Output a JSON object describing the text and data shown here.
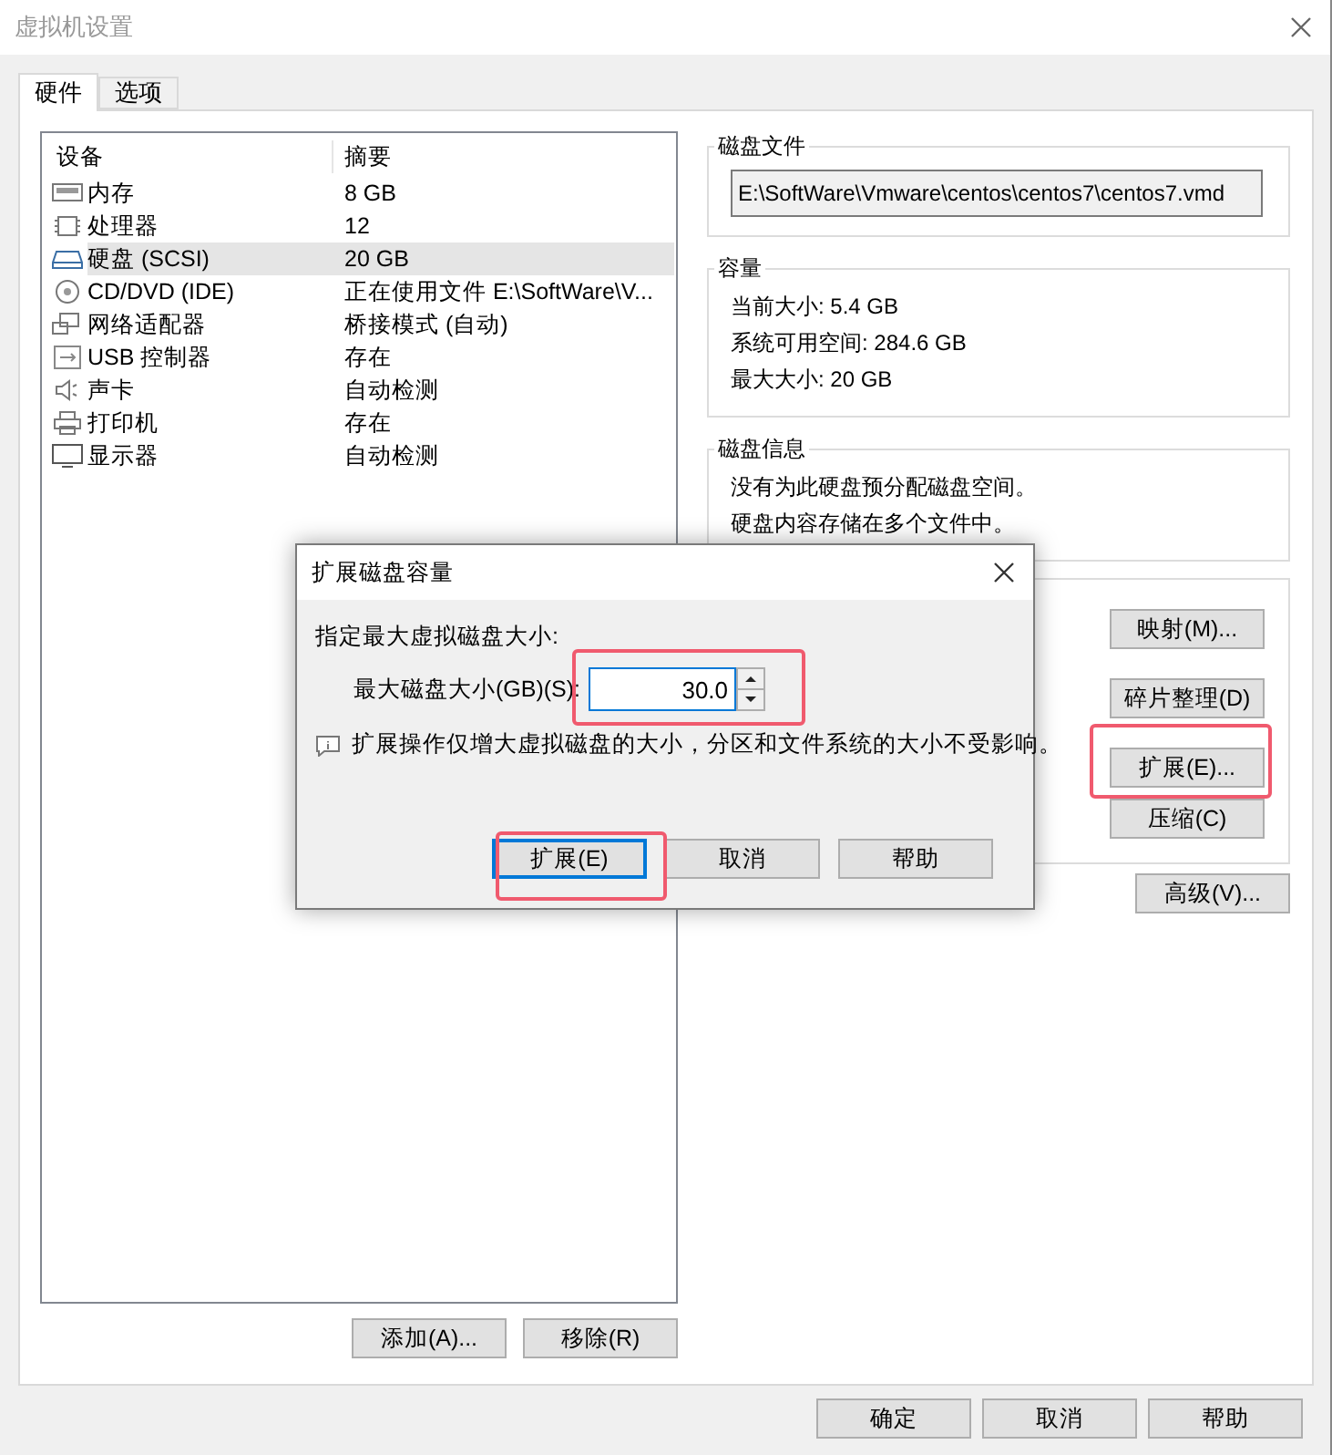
{
  "window": {
    "title": "虚拟机设置"
  },
  "tabs": [
    {
      "label": "硬件",
      "selected": true
    },
    {
      "label": "选项",
      "selected": false
    }
  ],
  "device_list": {
    "columns": [
      "设备",
      "摘要"
    ],
    "rows": [
      {
        "device": "内存",
        "summary": "8 GB",
        "selected": false
      },
      {
        "device": "处理器",
        "summary": "12",
        "selected": false
      },
      {
        "device": "硬盘 (SCSI)",
        "summary": "20 GB",
        "selected": true
      },
      {
        "device": "CD/DVD (IDE)",
        "summary": "正在使用文件 E:\\SoftWare\\V...",
        "selected": false
      },
      {
        "device": "网络适配器",
        "summary": "桥接模式 (自动)",
        "selected": false
      },
      {
        "device": "USB 控制器",
        "summary": "存在",
        "selected": false
      },
      {
        "device": "声卡",
        "summary": "自动检测",
        "selected": false
      },
      {
        "device": "打印机",
        "summary": "存在",
        "selected": false
      },
      {
        "device": "显示器",
        "summary": "自动检测",
        "selected": false
      }
    ]
  },
  "list_buttons": [
    "添加(A)...",
    "移除(R)"
  ],
  "disk_file": {
    "label": "磁盘文件",
    "value": "E:\\SoftWare\\Vmware\\centos\\centos7\\centos7.vmd"
  },
  "capacity": {
    "label": "容量",
    "lines": [
      "当前大小: 5.4 GB",
      "系统可用空间: 284.6 GB",
      "最大大小: 20 GB"
    ]
  },
  "disk_info": {
    "label": "磁盘信息",
    "lines": [
      "没有为此硬盘预分配磁盘空间。",
      "硬盘内容存储在多个文件中。"
    ]
  },
  "disk_tools": {
    "buttons": [
      "映射(M)...",
      "碎片整理(D)",
      "扩展(E)...",
      "压缩(C)"
    ]
  },
  "advanced_button": "高级(V)...",
  "footer_buttons": [
    "确定",
    "取消",
    "帮助"
  ],
  "dialog": {
    "title": "扩展磁盘容量",
    "prompt": "指定最大虚拟磁盘大小:",
    "field_label": "最大磁盘大小(GB)(S):",
    "value": "30.0",
    "note": "扩展操作仅增大虚拟磁盘的大小，分区和文件系统的大小不受影响。",
    "buttons": [
      {
        "label": "扩展(E)",
        "default": true
      },
      {
        "label": "取消",
        "default": false
      },
      {
        "label": "帮助",
        "default": false
      }
    ]
  }
}
